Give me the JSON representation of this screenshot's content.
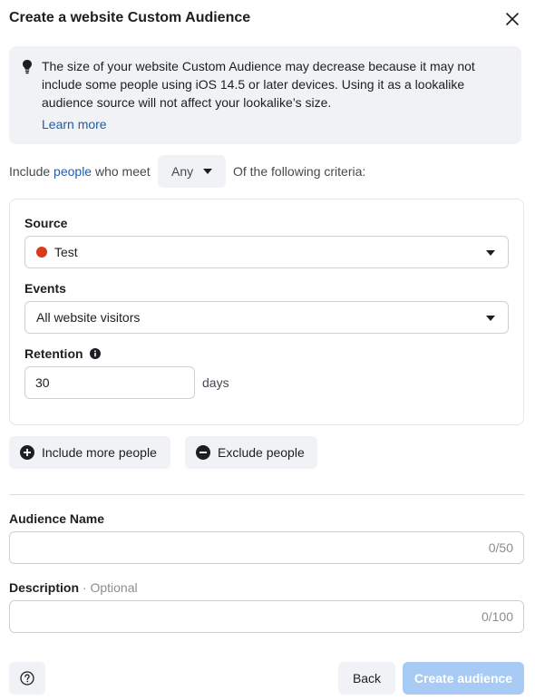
{
  "dialog": {
    "title": "Create a website Custom Audience",
    "close_icon": "close-icon"
  },
  "notice": {
    "icon": "lightbulb-icon",
    "text": "The size of your website Custom Audience may decrease because it may not include some people using iOS 14.5 or later devices. Using it as a lookalike audience source will not affect your lookalike’s size.",
    "link": "Learn more"
  },
  "criteria": {
    "prefix": "Include",
    "people_link": "people",
    "middle": "who meet",
    "match_value": "Any",
    "suffix": "Of the following criteria:"
  },
  "rule": {
    "source_label": "Source",
    "source_value": "Test",
    "source_dot_color": "#d93a1a",
    "events_label": "Events",
    "events_value": "All website visitors",
    "retention_label": "Retention",
    "retention_value": "30",
    "retention_unit": "days"
  },
  "actions": {
    "include_more": "Include more people",
    "exclude": "Exclude people"
  },
  "audience_name": {
    "label": "Audience Name",
    "value": "",
    "counter": "0/50"
  },
  "description": {
    "label": "Description",
    "optional": "· Optional",
    "value": "",
    "counter": "0/100"
  },
  "footer": {
    "help_icon": "question-icon",
    "back": "Back",
    "create": "Create audience",
    "create_color": "#a8cbf5"
  }
}
